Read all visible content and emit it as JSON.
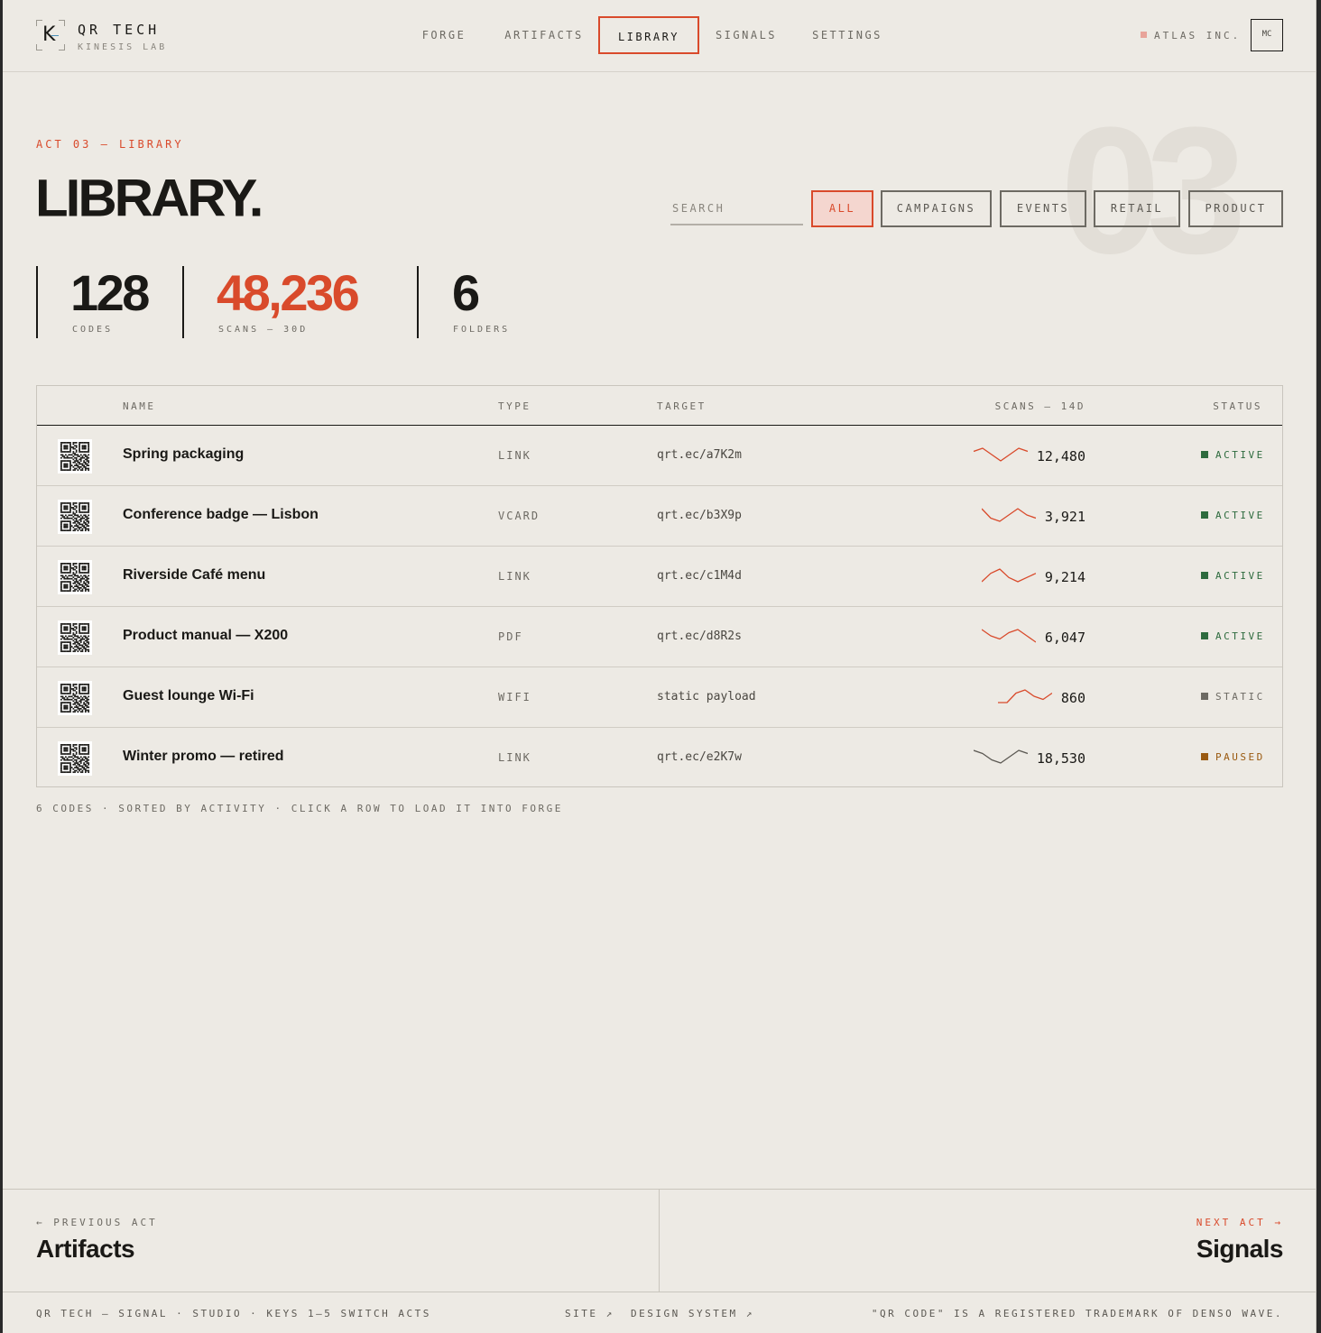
{
  "brand": {
    "logo_letter": "K",
    "name": "QR TECH",
    "sub": "KINESIS LAB"
  },
  "nav": {
    "items": [
      {
        "label": "FORGE",
        "active": false
      },
      {
        "label": "ARTIFACTS",
        "active": false
      },
      {
        "label": "LIBRARY",
        "active": true
      },
      {
        "label": "SIGNALS",
        "active": false
      },
      {
        "label": "SETTINGS",
        "active": false
      }
    ]
  },
  "org": {
    "name": "ATLAS INC.",
    "avatar": "MC"
  },
  "hero": {
    "eyebrow": "ACT 03 — LIBRARY",
    "title": "LIBRARY.",
    "bg_number": "03"
  },
  "search": {
    "placeholder": "SEARCH",
    "value": ""
  },
  "filters": [
    {
      "label": "ALL",
      "active": true
    },
    {
      "label": "CAMPAIGNS",
      "active": false
    },
    {
      "label": "EVENTS",
      "active": false
    },
    {
      "label": "RETAIL",
      "active": false
    },
    {
      "label": "PRODUCT",
      "active": false
    }
  ],
  "stats": [
    {
      "value": "128",
      "label": "CODES",
      "accent": false
    },
    {
      "value": "48,236",
      "label": "SCANS — 30D",
      "accent": true
    },
    {
      "value": "6",
      "label": "FOLDERS",
      "accent": false
    }
  ],
  "table": {
    "columns": [
      "NAME",
      "TYPE",
      "TARGET",
      "SCANS — 14D",
      "STATUS"
    ],
    "rows": [
      {
        "name": "Spring packaging",
        "type": "LINK",
        "target": "qrt.ec/a7K2m",
        "scans": "12,480",
        "status": "ACTIVE",
        "trend": [
          5,
          6,
          4,
          2,
          4,
          6,
          5
        ]
      },
      {
        "name": "Conference badge — Lisbon",
        "type": "VCARD",
        "target": "qrt.ec/b3X9p",
        "scans": "3,921",
        "status": "ACTIVE",
        "trend": [
          6,
          3,
          2,
          4,
          6,
          4,
          3
        ]
      },
      {
        "name": "Riverside Café menu",
        "type": "LINK",
        "target": "qrt.ec/c1M4d",
        "scans": "9,214",
        "status": "ACTIVE",
        "trend": [
          3,
          5,
          6,
          4,
          3,
          4,
          5
        ]
      },
      {
        "name": "Product manual — X200",
        "type": "PDF",
        "target": "qrt.ec/d8R2s",
        "scans": "6,047",
        "status": "ACTIVE",
        "trend": [
          6,
          4,
          3,
          5,
          6,
          4,
          2
        ]
      },
      {
        "name": "Guest lounge Wi-Fi",
        "type": "WIFI",
        "target": "static payload",
        "scans": "860",
        "status": "STATIC",
        "trend": [
          2,
          2,
          5,
          6,
          4,
          3,
          5
        ]
      },
      {
        "name": "Winter promo — retired",
        "type": "LINK",
        "target": "qrt.ec/e2K7w",
        "scans": "18,530",
        "status": "PAUSED",
        "trend": [
          6,
          5,
          3,
          2,
          4,
          6,
          5
        ]
      }
    ],
    "footnote": "6 CODES · SORTED BY ACTIVITY · CLICK A ROW TO LOAD IT INTO FORGE"
  },
  "acts": {
    "prev_label": "← PREVIOUS ACT",
    "prev_title": "Artifacts",
    "next_label": "NEXT ACT →",
    "next_title": "Signals"
  },
  "footer": {
    "left": "QR TECH — SIGNAL · STUDIO · KEYS 1–5 SWITCH ACTS",
    "site": "SITE ↗",
    "design_system": "DESIGN SYSTEM ↗",
    "right": "\"QR CODE\" IS A REGISTERED TRADEMARK OF DENSO WAVE."
  },
  "colors": {
    "accent": "#d94a2b",
    "active": "#2e6b3e",
    "static": "#6d6a63",
    "paused": "#9a5a10",
    "background": "#edeae4"
  },
  "icons": {
    "avatar": "user-initials",
    "qr": "qr-code-thumbnail"
  }
}
